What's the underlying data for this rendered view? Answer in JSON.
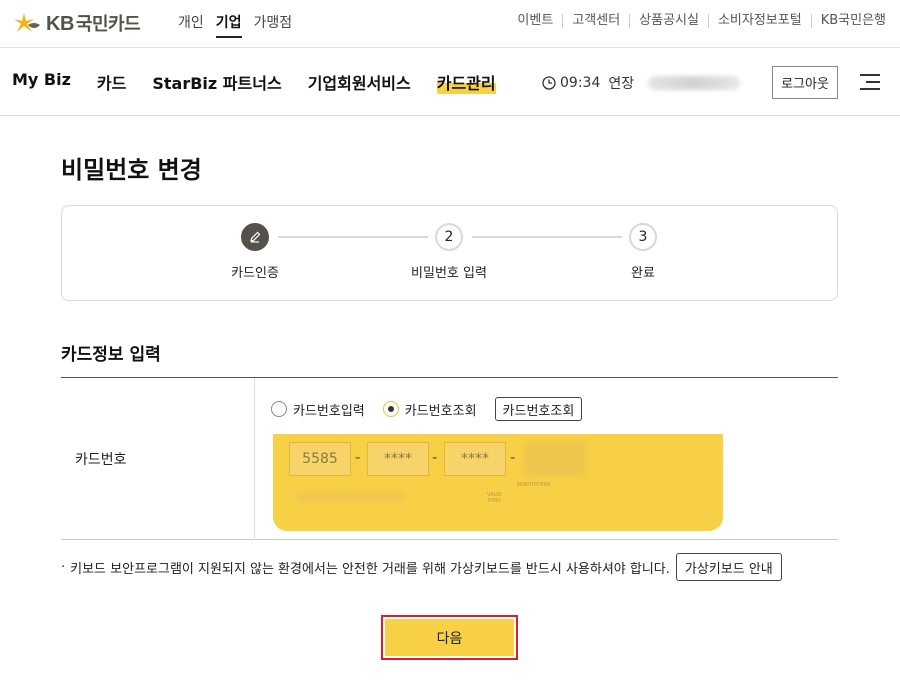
{
  "brand": {
    "kb": "KB",
    "name": "국민카드"
  },
  "segments": [
    {
      "label": "개인",
      "active": false
    },
    {
      "label": "기업",
      "active": true
    },
    {
      "label": "가맹점",
      "active": false
    }
  ],
  "utility_links": [
    "이벤트",
    "고객센터",
    "상품공시실",
    "소비자정보포털",
    "KB국민은행"
  ],
  "gnb": {
    "items": [
      "My Biz",
      "카드",
      "StarBiz 파트너스",
      "기업회원서비스",
      "카드관리"
    ],
    "active_index": 4,
    "session_time": "09:34",
    "extend_label": "연장",
    "logout_label": "로그아웃"
  },
  "page": {
    "title": "비밀번호 변경"
  },
  "steps": [
    {
      "number": "",
      "label": "카드인증",
      "state": "done",
      "icon": "pencil-icon"
    },
    {
      "number": "2",
      "label": "비밀번호 입력",
      "state": "pending"
    },
    {
      "number": "3",
      "label": "완료",
      "state": "pending"
    }
  ],
  "card_info": {
    "section_title": "카드정보 입력",
    "field_label": "카드번호",
    "radio_options": [
      {
        "label": "카드번호입력",
        "checked": false
      },
      {
        "label": "카드번호조회",
        "checked": true
      }
    ],
    "lookup_button": "카드번호조회",
    "card_segments": [
      "5585",
      "****",
      "****"
    ],
    "dash": "-",
    "valid_thru": "VALID THRU",
    "month_year": "MONTH/YEAR"
  },
  "notice": {
    "bullet": "·",
    "text": "키보드 보안프로그램이 지원되지 않는 환경에서는 안전한 거래를 위해 가상키보드를 반드시 사용하셔야 합니다.",
    "button": "가상키보드 안내"
  },
  "next_button": "다음",
  "colors": {
    "accent": "#f7d046",
    "brand_gray": "#55504a",
    "highlight_border": "#d81f2a"
  }
}
